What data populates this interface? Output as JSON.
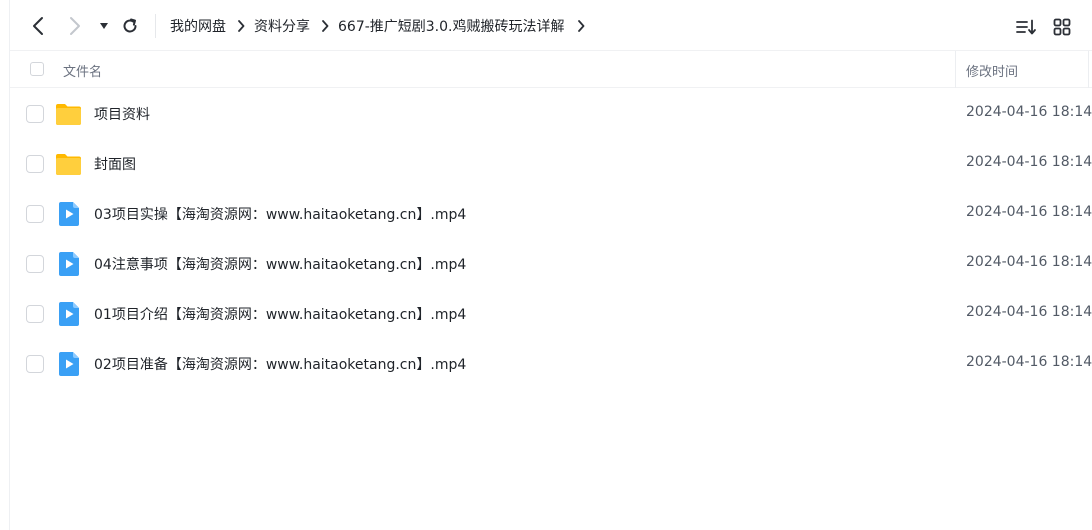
{
  "toolbar": {
    "back_icon": "chevron-left-icon",
    "forward_icon": "chevron-right-icon",
    "history_icon": "caret-down-icon",
    "refresh_icon": "refresh-icon",
    "sort_icon": "sort-list-icon",
    "grid_icon": "grid-view-icon"
  },
  "breadcrumb": {
    "items": [
      "我的网盘",
      "资料分享",
      "667-推广短剧3.0.鸡贼搬砖玩法详解"
    ]
  },
  "header": {
    "name": "文件名",
    "time": "修改时间"
  },
  "colors": {
    "folder": "#ffc629",
    "video": "#3aa0f5",
    "accent_text": "#1f2329",
    "muted_text": "#6b7280"
  },
  "files": [
    {
      "name": "项目资料",
      "type": "folder",
      "time": "2024-04-16 18:14"
    },
    {
      "name": "封面图",
      "type": "folder",
      "time": "2024-04-16 18:14"
    },
    {
      "name": "03项目实操【海淘资源网：www.haitaoketang.cn】.mp4",
      "type": "video",
      "time": "2024-04-16 18:14"
    },
    {
      "name": "04注意事项【海淘资源网：www.haitaoketang.cn】.mp4",
      "type": "video",
      "time": "2024-04-16 18:14"
    },
    {
      "name": "01项目介绍【海淘资源网：www.haitaoketang.cn】.mp4",
      "type": "video",
      "time": "2024-04-16 18:14"
    },
    {
      "name": "02项目准备【海淘资源网：www.haitaoketang.cn】.mp4",
      "type": "video",
      "time": "2024-04-16 18:14"
    }
  ]
}
